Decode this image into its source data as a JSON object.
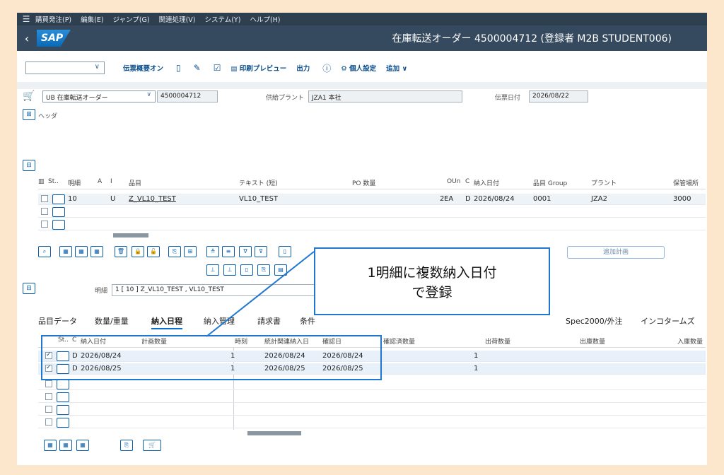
{
  "menu": [
    "購買発注(P)",
    "編集(E)",
    "ジャンプ(G)",
    "関連処理(V)",
    "システム(Y)",
    "ヘルプ(H)"
  ],
  "title": "在庫転送オーダー 4500004712 (登録者 M2B STUDENT006)",
  "toolbar": {
    "doc_overview": "伝票概要オン",
    "print_preview": "印刷プレビュー",
    "output": "出力",
    "personal_settings": "個人設定",
    "more": "追加 ∨"
  },
  "header": {
    "doc_type": "UB 在庫転送オーダー",
    "po_number": "4500004712",
    "supplying_plant_label": "供給プラント",
    "supplying_plant": "JZA1 本社",
    "doc_date_label": "伝票日付",
    "doc_date": "2026/08/22",
    "header_label": "ヘッダ"
  },
  "item_table": {
    "columns": [
      "St..",
      "明細",
      "A",
      "I",
      "品目",
      "テキスト (短)",
      "PO 数量",
      "OUn",
      "C",
      "納入日付",
      "品目 Group",
      "プラント",
      "保管場所"
    ],
    "rows": [
      {
        "item": "10",
        "i": "U",
        "material": "Z_VL10_TEST",
        "text": "VL10_TEST",
        "qty": "2",
        "unit": "EA",
        "c": "D",
        "date": "2026/08/24",
        "group": "0001",
        "plant": "JZA2",
        "sloc": "3000"
      }
    ]
  },
  "add_plan_button": "追加計画",
  "item_selector_label": "明細",
  "item_selector_value": "1 [ 10 ] Z_VL10_TEST , VL10_TEST",
  "tabs": [
    "品目データ",
    "数量/重量",
    "納入日程",
    "納入管理",
    "請求書",
    "条件",
    "Spec2000/外注",
    "インコタームズ"
  ],
  "schedule_table": {
    "columns": [
      "St..",
      "C",
      "納入日付",
      "計画数量",
      "時刻",
      "統計関連納入日",
      "確認日",
      "確認済数量",
      "出荷数量",
      "出庫数量",
      "入庫数量"
    ],
    "rows": [
      {
        "c": "D",
        "date": "2026/08/24",
        "qty": "1",
        "stat_date": "2026/08/24",
        "confirm": "2026/08/24",
        "confirmed_qty": "1"
      },
      {
        "c": "D",
        "date": "2026/08/25",
        "qty": "1",
        "stat_date": "2026/08/25",
        "confirm": "2026/08/25",
        "confirmed_qty": "1"
      }
    ]
  },
  "callout": {
    "line1": "1明細に複数納入日付",
    "line2": "で登録"
  }
}
